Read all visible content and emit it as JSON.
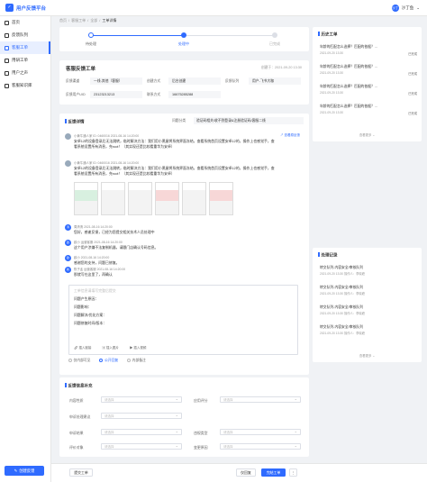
{
  "app": {
    "title": "用户反馈平台",
    "logo_glyph": "✓"
  },
  "user": {
    "avatar": "沙丁",
    "name": "沙丁鱼"
  },
  "nav": [
    {
      "label": "首页"
    },
    {
      "label": "反馈队列"
    },
    {
      "label": "客服工单"
    },
    {
      "label": "用研工单"
    },
    {
      "label": "用户之声"
    },
    {
      "label": "客服知识库"
    }
  ],
  "create_button": "创建反馈",
  "breadcrumb": [
    "首页",
    "/",
    "客服工单",
    "/",
    "全部",
    "/",
    "工单详情"
  ],
  "steps": [
    {
      "label": "待处理",
      "state": "done"
    },
    {
      "label": "处理中",
      "state": "current"
    },
    {
      "label": "已完成",
      "state": "todo"
    }
  ],
  "ticket": {
    "title": "客服反馈工单",
    "created": "创建于：2021-09-20 13:30",
    "fields": [
      {
        "label": "反馈渠道",
        "value": "一线-其他（客服）"
      },
      {
        "label": "创建方式",
        "value": "后台创建"
      },
      {
        "label": "反馈队列",
        "value": "用户-飞书大咖"
      },
      {
        "label": "反馈用户UID",
        "value": "23123213213"
      },
      {
        "label": "联系方式",
        "value": "16675285288"
      }
    ]
  },
  "detail": {
    "title": "反馈详情",
    "category_label": "问题分类",
    "category_value": "验证码相关/收不到登录&注册验证码/客服二线",
    "messages": [
      {
        "head": "小黄牛通人家 ID: 0460016  2021-08-16 14:20:00",
        "text": "安卓12的设备登录后无法跳转，临时解决方法：我们用小黑屋将系统界面冻结，查看系统首页设置安卓12的，操作上也感觉手，查看系统设置所有消息，充root！（其实现还是比较看重华为安卓）"
      },
      {
        "head": "小黄牛通人家 ID: 0460016  2021-08-16 14:20:00",
        "text": "安卓12的设备登录后无法跳转，临时解决方法：我们用小黑屋将系统界面冻结，查看系统首页设置安卓12的，操作上也感觉手，查看系统设置所有消息，充root！（其实现还是比较看重华为安卓）"
      },
      {
        "avatar": "清",
        "head": "周清清  2021-08-16 14:20:00",
        "text": "您好，感谢反馈，已经为您提交相关技术人员处理中"
      },
      {
        "avatar": "欧",
        "head": "欧小  运营客服  2021-08-16 14:20:00",
        "text": "这个用户涉嫌不法复制机器，请跟门店确认号码信息。"
      },
      {
        "avatar": "欧",
        "head": "欧小  2021-08-16 14:20:00",
        "text": "感谢您的支持，问题已修复。"
      },
      {
        "avatar": "新",
        "head": "陈子孟  运营客服  2021-08-16 14:20:00",
        "text": "那就写在这里了，再确认"
      }
    ],
    "editor": {
      "placeholder": "工单信息请填写完整后提交",
      "lines": [
        "问题产生原因：",
        "问题影响：",
        "问题解决/优化方案：",
        "问题修复时间/版本："
      ],
      "tools": [
        "插入链接",
        "插入图片",
        "插入视频"
      ]
    },
    "visibility": [
      {
        "label": "仅内部可见",
        "on": false
      },
      {
        "label": "公开回复",
        "on": true
      },
      {
        "label": "内部备注",
        "on": false
      }
    ],
    "expand_link": "展开全部"
  },
  "supplement": {
    "title": "反馈信息补充",
    "fields": [
      {
        "label": "内容性质",
        "placeholder": "请选择"
      },
      {
        "label": "应用评分",
        "placeholder": "请选择"
      },
      {
        "label": "申诉处理建议",
        "placeholder": "请选择"
      },
      {
        "label": "申诉结果",
        "placeholder": "请选择"
      },
      {
        "label": "违规类型",
        "placeholder": "请选择"
      },
      {
        "label": "评价对象",
        "placeholder": "请选择"
      },
      {
        "label": "变更原因",
        "placeholder": "请选择"
      }
    ]
  },
  "footer": {
    "left_button": "提交工单",
    "reply_button": "仅回复",
    "primary_button": "完结工单",
    "more_button": "⋮"
  },
  "history": {
    "title": "历史工单",
    "items": [
      {
        "text": "年龄的匹配怎么选择？匹配的依据？...",
        "time": "2021-09-20 13:30",
        "status": "已完成"
      },
      {
        "text": "年龄的匹配怎么选择？匹配的依据？...",
        "time": "2021-09-20 13:30",
        "status": "已完成"
      },
      {
        "text": "年龄的匹配怎么选择？匹配的依据？...",
        "time": "2021-09-20 13:30",
        "status": "已完成"
      },
      {
        "text": "年龄的匹配怎么选择？匹配的依据？...",
        "time": "2021-09-20 13:30",
        "status": "已完成"
      }
    ],
    "more": "查看更多 ⌄"
  },
  "records": {
    "title": "处理记录",
    "items": [
      {
        "text": "转交队列-内容安全/审核队列",
        "sub": "2021-09-20 13:30  操作人：李晓峰"
      },
      {
        "text": "转交队列-内容安全/审核队列",
        "sub": "2021-09-20 13:30  操作人：李晓峰"
      },
      {
        "text": "转交队列-内容安全/审核队列",
        "sub": "2021-09-20 13:30  操作人：李晓峰"
      },
      {
        "text": "转交队列-内容安全/审核队列",
        "sub": "2021-09-20 13:30  操作人：李晓峰"
      }
    ],
    "more": "查看更多 ⌄"
  }
}
